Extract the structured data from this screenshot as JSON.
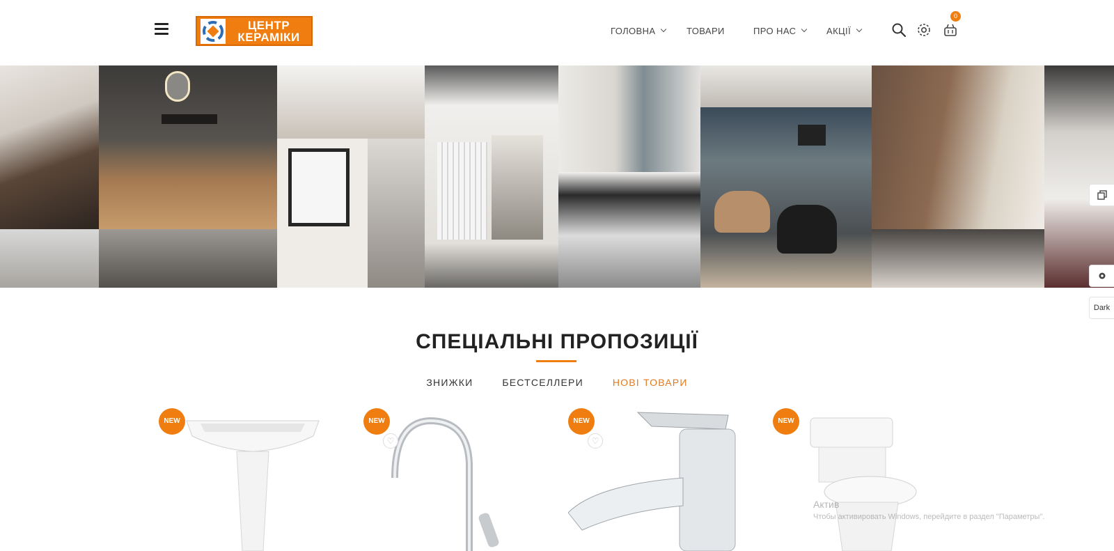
{
  "header": {
    "logo_line1": "ЦЕНТР",
    "logo_line2": "КЕРАМІКИ",
    "nav": [
      {
        "label": "ГОЛОВНА",
        "has_dropdown": true
      },
      {
        "label": "ТОВАРИ",
        "has_dropdown": false
      },
      {
        "label": "ПРО НАС",
        "has_dropdown": true
      },
      {
        "label": "АКЦІЇ",
        "has_dropdown": true
      }
    ],
    "icons": [
      "menu-icon",
      "search-icon",
      "settings-icon",
      "cart-icon"
    ],
    "cart_count": "0"
  },
  "side_tools": {
    "dark_label": "Dark"
  },
  "section": {
    "title": "СПЕЦІАЛЬНІ ПРОПОЗИЦІЇ",
    "tabs": [
      {
        "label": "ЗНИЖКИ",
        "active": false
      },
      {
        "label": "БЕСТСЕЛЛЕРИ",
        "active": false
      },
      {
        "label": "НОВІ ТОВАРИ",
        "active": true
      }
    ]
  },
  "products": [
    {
      "badge": "NEW",
      "kind": "pedestal-sink"
    },
    {
      "badge": "NEW",
      "kind": "kitchen-faucet"
    },
    {
      "badge": "NEW",
      "kind": "basin-faucet"
    },
    {
      "badge": "NEW",
      "kind": "toilet"
    }
  ],
  "watermark": {
    "line1": "Актив",
    "line2": "Чтобы активировать Windows, перейдите в раздел \"Параметры\"."
  },
  "colors": {
    "accent": "#ef7d0f",
    "active_tab": "#e07a20",
    "text": "#333333"
  }
}
